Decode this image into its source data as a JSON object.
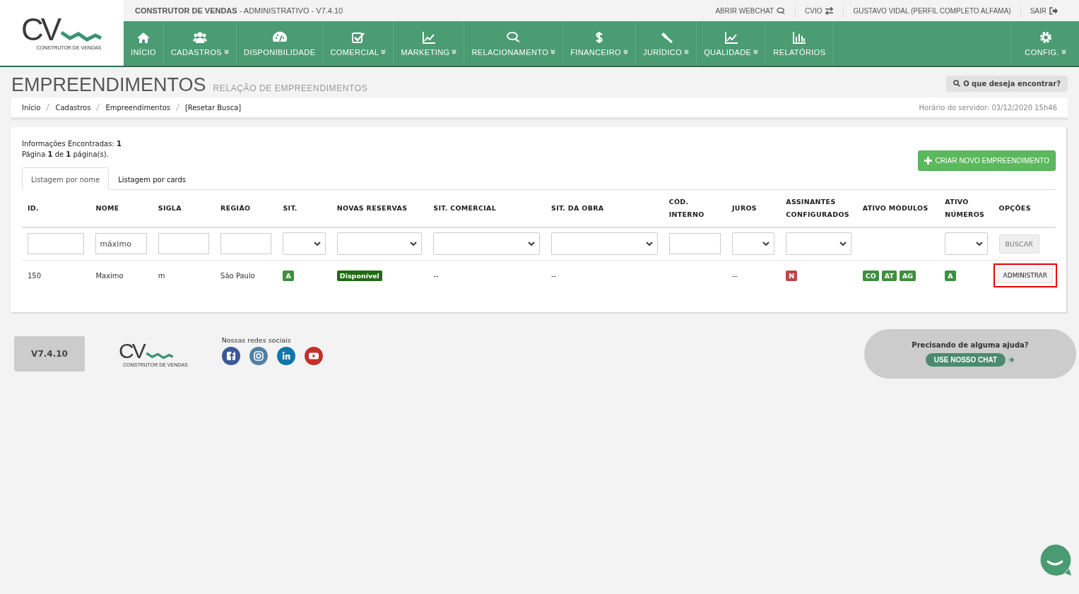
{
  "header": {
    "logo_mark": "CV",
    "logo_caption": "CONSTRUTOR DE VENDAS",
    "app_name": "CONSTRUTOR DE VENDAS",
    "app_suffix": " - ADMINISTRATIVO - V7.4.10",
    "top_links": [
      {
        "label": "ABRIR WEBCHAT"
      },
      {
        "label": "CVIO"
      },
      {
        "label": "GUSTAVO VIDAL (PERFIL COMPLETO ALFAMA)"
      },
      {
        "label": "SAIR"
      }
    ]
  },
  "nav": [
    {
      "label": "INÍCIO",
      "dropdown": false
    },
    {
      "label": "CADASTROS",
      "dropdown": true
    },
    {
      "label": "DISPONIBILIDADE",
      "dropdown": false
    },
    {
      "label": "COMERCIAL",
      "dropdown": true
    },
    {
      "label": "MARKETING",
      "dropdown": true
    },
    {
      "label": "RELACIONAMENTO",
      "dropdown": true
    },
    {
      "label": "FINANCEIRO",
      "dropdown": true
    },
    {
      "label": "JURÍDICO",
      "dropdown": true
    },
    {
      "label": "QUALIDADE",
      "dropdown": true
    },
    {
      "label": "RELATÓRIOS",
      "dropdown": false
    },
    {
      "label": "CONFIG.",
      "dropdown": true
    }
  ],
  "page": {
    "title": "EMPREENDIMENTOS",
    "subtitle": "RELAÇÃO DE EMPREENDIMENTOS",
    "search_button": "O que deseja encontrar?"
  },
  "breadcrumb": {
    "items": [
      "Início",
      "Cadastros",
      "Empreendimentos",
      "[Resetar Busca]"
    ],
    "server_time": "Horário do servidor: 03/12/2020 15h46"
  },
  "info": [
    "Informações Encontradas: **1**",
    "Página **1** de **1** página(s)."
  ],
  "create_button": "CRIAR NOVO EMPREENDIMENTO",
  "tabs": [
    {
      "label": "Listagem por nome",
      "selected": true
    },
    {
      "label": "Listagem por cards",
      "selected": false
    }
  ],
  "table": {
    "columns": [
      "ID.",
      "NOME",
      "SIGLA",
      "REGIÃO",
      "SIT.",
      "NOVAS RESERVAS",
      "SIT. COMERCIAL",
      "SIT. DA OBRA",
      "CÓD.\nINTERNO",
      "JUROS",
      "ASSINANTES\nCONFIGURADOS",
      "ATIVO MÓDULOS",
      "ATIVO\nNÚMEROS",
      "OPÇÕES"
    ],
    "filters": [
      {
        "kind": "text"
      },
      {
        "kind": "text",
        "value": "máximo"
      },
      {
        "kind": "text"
      },
      {
        "kind": "text"
      },
      {
        "kind": "select"
      },
      {
        "kind": "select"
      },
      {
        "kind": "select"
      },
      {
        "kind": "select"
      },
      {
        "kind": "text"
      },
      {
        "kind": "select"
      },
      {
        "kind": "select"
      },
      {
        "kind": "none"
      },
      {
        "kind": "select"
      },
      {
        "kind": "button",
        "label": "BUSCAR"
      }
    ],
    "rows": [
      {
        "cells": [
          {
            "kind": "text",
            "text": "150"
          },
          {
            "kind": "text",
            "text": "Maximo"
          },
          {
            "kind": "text",
            "text": "m"
          },
          {
            "kind": "text",
            "text": "São Paulo"
          },
          {
            "kind": "badges",
            "badges": [
              {
                "text": "A",
                "color": "#3f8f3f"
              }
            ]
          },
          {
            "kind": "badges",
            "badges": [
              {
                "text": "Disponível",
                "color": "#1f6b12"
              }
            ]
          },
          {
            "kind": "text",
            "text": "--"
          },
          {
            "kind": "text",
            "text": "--"
          },
          {
            "kind": "text",
            "text": ""
          },
          {
            "kind": "text",
            "text": "--"
          },
          {
            "kind": "badges",
            "badges": [
              {
                "text": "N",
                "color": "#b94a48"
              }
            ]
          },
          {
            "kind": "badges",
            "badges": [
              {
                "text": "CO",
                "color": "#3f8f3f"
              },
              {
                "text": "AT",
                "color": "#3f8f3f"
              },
              {
                "text": "AG",
                "color": "#3f8f3f"
              }
            ]
          },
          {
            "kind": "badges",
            "badges": [
              {
                "text": "A",
                "color": "#3f8f3f"
              }
            ]
          },
          {
            "kind": "button",
            "text": "ADMINISTRAR",
            "highlighted": true
          }
        ]
      }
    ]
  },
  "footer": {
    "version": "V7.4.10",
    "logo_mark": "CV",
    "logo_caption": "CONSTRUTOR DE VENDAS",
    "social_label": "Nossas redes sociais",
    "help_text": "Precisando de alguma ajuda?",
    "chat_button": "USE NOSSO CHAT"
  }
}
